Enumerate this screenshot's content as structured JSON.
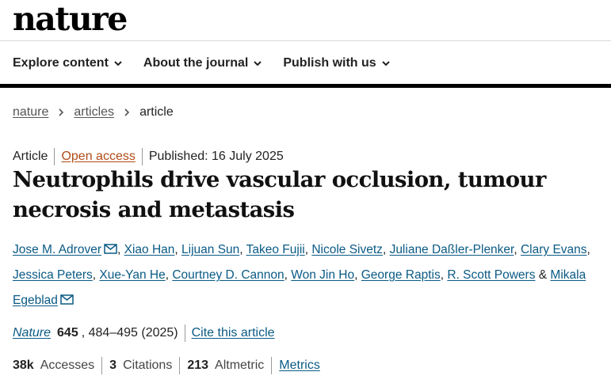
{
  "site": {
    "logo": "nature"
  },
  "nav": {
    "items": [
      {
        "label": "Explore content"
      },
      {
        "label": "About the journal"
      },
      {
        "label": "Publish with us"
      }
    ]
  },
  "breadcrumb": {
    "items": [
      "nature",
      "articles"
    ],
    "current": "article"
  },
  "meta": {
    "type": "Article",
    "access": "Open access",
    "published": "Published: 16 July 2025"
  },
  "article": {
    "title": "Neutrophils drive vascular occlusion, tumour necrosis and metastasis"
  },
  "authors": [
    "Jose M. Adrover",
    "Xiao Han",
    "Lijuan Sun",
    "Takeo Fujii",
    "Nicole Sivetz",
    "Juliane Daßler-Plenker",
    "Clary Evans",
    "Jessica Peters",
    "Xue-Yan He",
    "Courtney D. Cannon",
    "Won Jin Ho",
    "George Raptis",
    "R. Scott Powers",
    "Mikala Egeblad"
  ],
  "author_conjunction": "&",
  "citation": {
    "journal": "Nature",
    "volume": "645",
    "pages_year": ", 484–495 (2025)",
    "cite_label": "Cite this article"
  },
  "metrics": {
    "accesses_value": "38k",
    "accesses_label": "Accesses",
    "citations_value": "3",
    "citations_label": "Citations",
    "altmetric_value": "213",
    "altmetric_label": "Altmetric",
    "link_label": "Metrics"
  },
  "colors": {
    "link": "#0a5a85",
    "open_access": "#b04a16"
  }
}
